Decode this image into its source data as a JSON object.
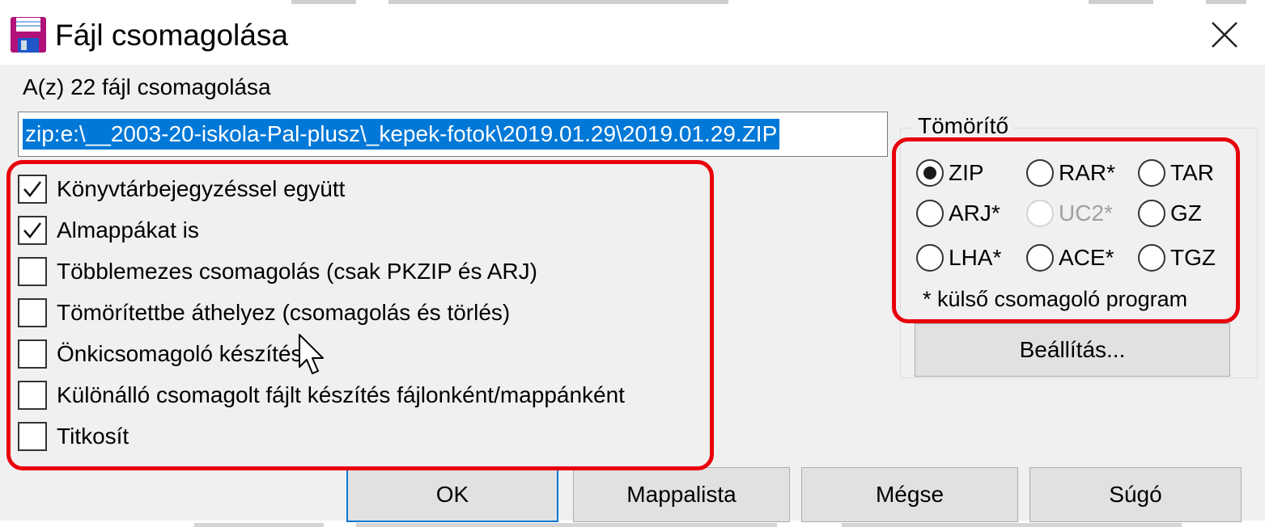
{
  "window": {
    "title": "Fájl csomagolása",
    "icon": "floppy-disk-icon"
  },
  "subtitle": "A(z) 22 fájl csomagolása",
  "target_path": {
    "value": "zip:e:\\__2003-20-iskola-Pal-plusz\\_kepek-fotok\\2019.01.29\\2019.01.29.ZIP"
  },
  "options": [
    {
      "label": "Könyvtárbejegyzéssel együtt",
      "checked": true
    },
    {
      "label": "Almappákat is",
      "checked": true
    },
    {
      "label": "Többlemezes csomagolás (csak PKZIP és ARJ)",
      "checked": false
    },
    {
      "label": "Tömörítettbe áthelyez (csomagolás és törlés)",
      "checked": false
    },
    {
      "label": "Önkicsomagoló készítése",
      "checked": false
    },
    {
      "label": "Különálló csomagolt fájlt készítés fájlonként/mappánként",
      "checked": false
    },
    {
      "label": "Titkosít",
      "checked": false
    }
  ],
  "compressor": {
    "title": "Tömörítő",
    "formats": [
      {
        "label": "ZIP",
        "selected": true,
        "enabled": true
      },
      {
        "label": "RAR*",
        "selected": false,
        "enabled": true
      },
      {
        "label": "TAR",
        "selected": false,
        "enabled": true
      },
      {
        "label": "ARJ*",
        "selected": false,
        "enabled": true
      },
      {
        "label": "UC2*",
        "selected": false,
        "enabled": false
      },
      {
        "label": "GZ",
        "selected": false,
        "enabled": true
      },
      {
        "label": "LHA*",
        "selected": false,
        "enabled": true
      },
      {
        "label": "ACE*",
        "selected": false,
        "enabled": true
      },
      {
        "label": "TGZ",
        "selected": false,
        "enabled": true
      }
    ],
    "note": "* külső csomagoló program",
    "settings_label": "Beállítás..."
  },
  "buttons": {
    "ok": "OK",
    "folder_list": "Mappalista",
    "cancel": "Mégse",
    "help": "Súgó"
  },
  "colors": {
    "highlight": "#e8000b",
    "selection": "#0078d7",
    "default_button_border": "#0078d7"
  }
}
